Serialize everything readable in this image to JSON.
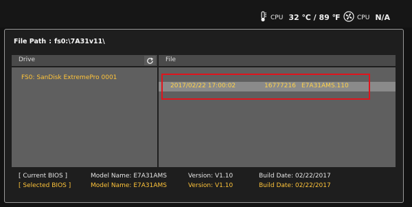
{
  "status": {
    "cpu_temp_label": "CPU",
    "cpu_temp_value": "32 ℃ / 89 ℉",
    "cpu_fan_label": "CPU",
    "cpu_fan_value": "N/A"
  },
  "file_path": {
    "label": "File Path",
    "separator": ":",
    "value": "fs0:\\7A31v11\\"
  },
  "drive_pane": {
    "header": "Drive",
    "items": [
      "FS0: SanDisk ExtremePro 0001"
    ]
  },
  "file_pane": {
    "header": "File",
    "updir": "..",
    "rows": [
      {
        "date": "2017/02/22 17:00:02",
        "size": "16777216",
        "name": "E7A31AMS.110"
      }
    ]
  },
  "bios_info": {
    "current": {
      "label": "[ Current BIOS ]",
      "model": "Model Name: E7A31AMS",
      "version": "Version: V1.10",
      "build": "Build Date: 02/22/2017"
    },
    "selected": {
      "label": "[ Selected BIOS ]",
      "model": "Model Name: E7A31AMS",
      "version": "Version: V1.10",
      "build": "Build Date: 02/22/2017"
    }
  },
  "colors": {
    "accent_yellow": "#ffc43a",
    "highlight_red": "#e0141c",
    "pane_gray": "#5f5f5f",
    "selected_row": "#8a8a8a"
  },
  "icons": [
    "thermometer-icon",
    "fan-icon",
    "refresh-icon"
  ]
}
